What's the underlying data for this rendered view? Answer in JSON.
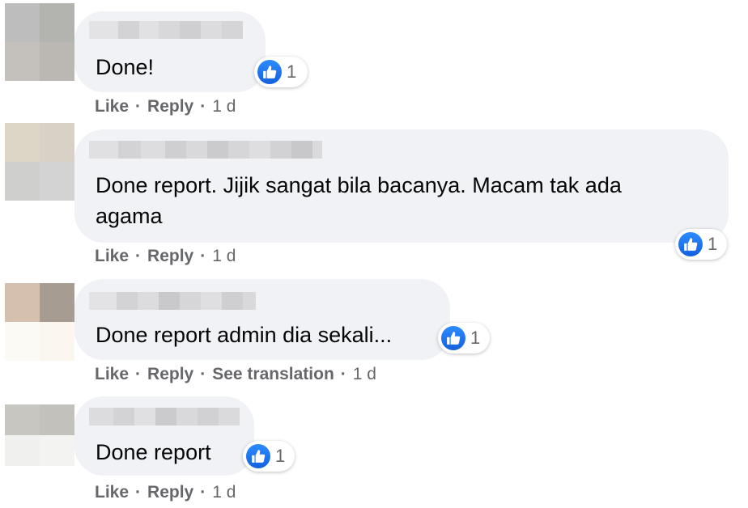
{
  "comments": [
    {
      "text": "Done!",
      "reaction_count": "1",
      "actions": {
        "like": "Like",
        "reply": "Reply",
        "time": "1 d"
      }
    },
    {
      "text": "Done report. Jijik sangat bila bacanya. Macam tak ada agama",
      "reaction_count": "1",
      "actions": {
        "like": "Like",
        "reply": "Reply",
        "time": "1 d"
      }
    },
    {
      "text": "Done report admin dia sekali...",
      "reaction_count": "1",
      "actions": {
        "like": "Like",
        "reply": "Reply",
        "see_translation": "See translation",
        "time": "1 d"
      }
    },
    {
      "text": "Done report",
      "reaction_count": "1",
      "actions": {
        "like": "Like",
        "reply": "Reply",
        "time": "1 d"
      }
    }
  ],
  "colors": {
    "bubble": "#f0f2f5",
    "text": "#050505",
    "meta": "#65676b",
    "like_blue": "#1877f2"
  },
  "icons": {
    "reaction": "like-thumbs-up-icon",
    "avatar": "pixelated-avatar",
    "name": "pixelated-name"
  }
}
